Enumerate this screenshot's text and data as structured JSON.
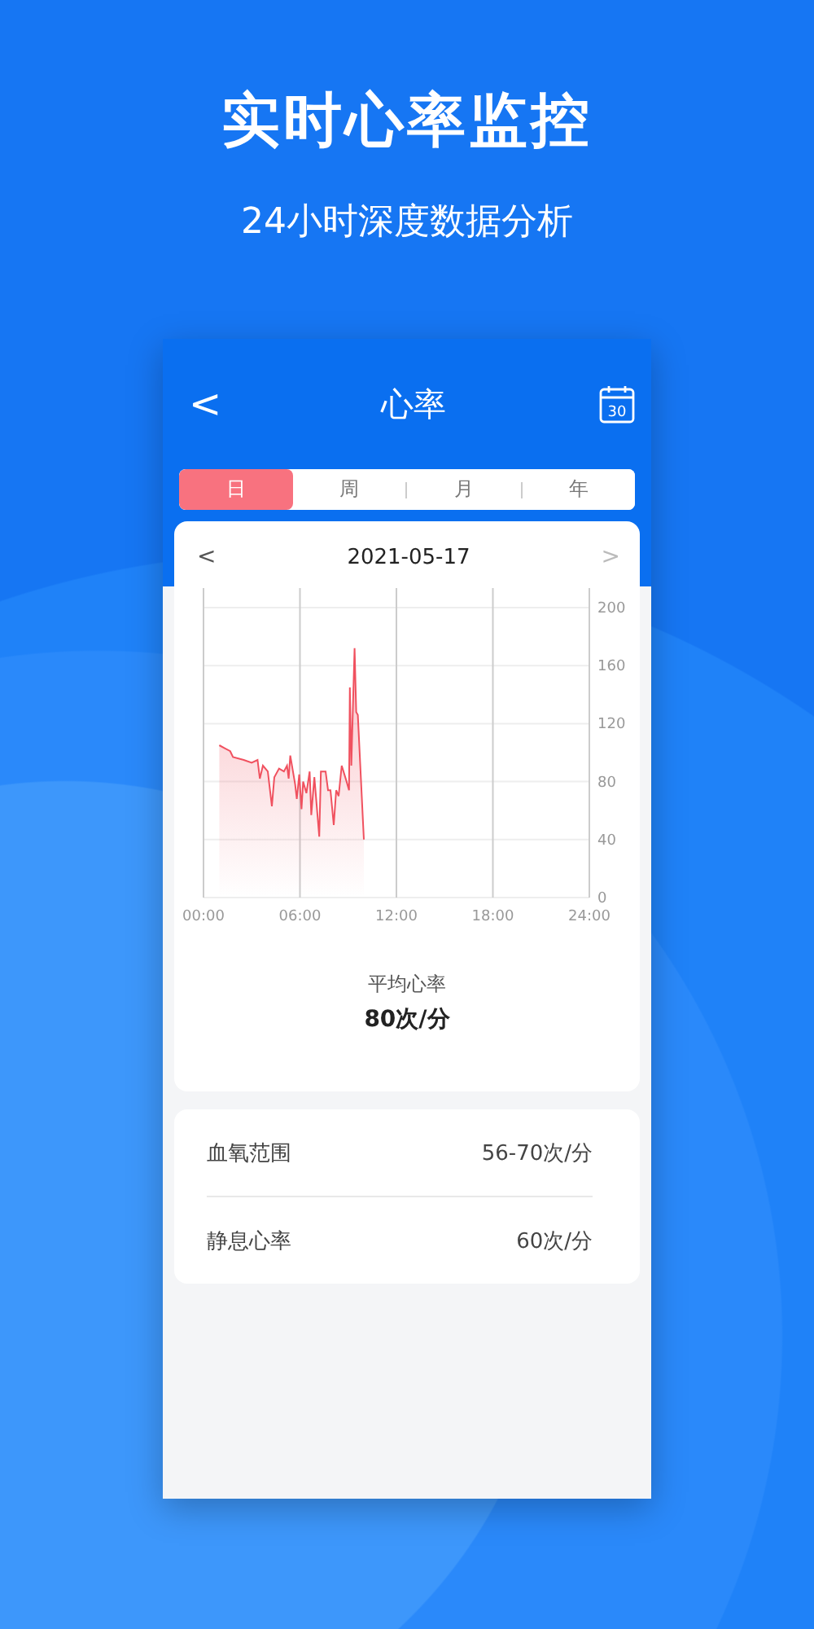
{
  "headline": "实时心率监控",
  "subheadline": "24小时深度数据分析",
  "nav": {
    "back": "<",
    "title": "心率",
    "calendar_day": "30"
  },
  "tabs": [
    {
      "label": "日",
      "selected": true
    },
    {
      "label": "周",
      "selected": false
    },
    {
      "label": "月",
      "selected": false
    },
    {
      "label": "年",
      "selected": false
    }
  ],
  "date_nav": {
    "prev": "<",
    "date": "2021-05-17",
    "next": ">"
  },
  "chart_data": {
    "type": "area",
    "xlim": [
      0,
      24
    ],
    "ylim": [
      0,
      200
    ],
    "xticks": [
      {
        "value": 0,
        "label": "00:00"
      },
      {
        "value": 6,
        "label": "06:00"
      },
      {
        "value": 12,
        "label": "12:00"
      },
      {
        "value": 18,
        "label": "18:00"
      },
      {
        "value": 24,
        "label": "24:00"
      }
    ],
    "yticks": [
      0,
      40,
      80,
      120,
      160,
      200
    ],
    "x": [
      0.98,
      1.32,
      1.66,
      1.83,
      2.5,
      3.0,
      3.36,
      3.5,
      3.7,
      4.0,
      4.25,
      4.4,
      4.7,
      5.0,
      5.2,
      5.3,
      5.4,
      5.7,
      5.8,
      5.95,
      6.1,
      6.2,
      6.4,
      6.6,
      6.7,
      6.9,
      7.2,
      7.3,
      7.6,
      7.75,
      7.9,
      8.1,
      8.25,
      8.4,
      8.6,
      8.9,
      9.05,
      9.1,
      9.2,
      9.3,
      9.4,
      9.5,
      9.6,
      9.97
    ],
    "grid": true,
    "series": [
      {
        "color": "#f0515f",
        "values": [
          105,
          103,
          101,
          97,
          95,
          93,
          95,
          82,
          91,
          87,
          63,
          83,
          89,
          87,
          91,
          82,
          98,
          78,
          68,
          85,
          61,
          80,
          72,
          87,
          57,
          83,
          42,
          87,
          87,
          74,
          74,
          50,
          74,
          70,
          91,
          80,
          74,
          145,
          91,
          132,
          172,
          128,
          126,
          40
        ]
      }
    ]
  },
  "average": {
    "label": "平均心率",
    "value": "80次/分"
  },
  "stats": [
    {
      "label": "血氧范围",
      "value": "56-70次/分"
    },
    {
      "label": "静息心率",
      "value": "60次/分"
    }
  ]
}
